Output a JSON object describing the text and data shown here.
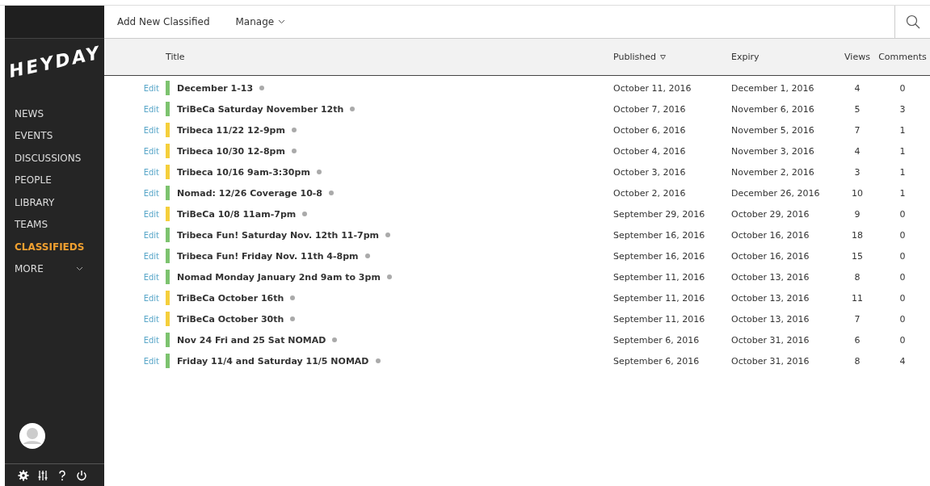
{
  "logo": "HEYDAY",
  "nav": [
    {
      "label": "NEWS",
      "selected": false
    },
    {
      "label": "EVENTS",
      "selected": false
    },
    {
      "label": "DISCUSSIONS",
      "selected": false
    },
    {
      "label": "PEOPLE",
      "selected": false
    },
    {
      "label": "LIBRARY",
      "selected": false
    },
    {
      "label": "TEAMS",
      "selected": false
    },
    {
      "label": "CLASSIFIEDS",
      "selected": true
    },
    {
      "label": "MORE",
      "selected": false,
      "has_menu": true
    }
  ],
  "toolbar": {
    "add": "Add New Classified",
    "manage": "Manage"
  },
  "columns": {
    "title": "Title",
    "published": "Published",
    "expiry": "Expiry",
    "views": "Views",
    "comments": "Comments"
  },
  "rows": [
    {
      "edit": "Edit",
      "color": "#7dc36f",
      "title": "December 1-13",
      "published": "October 11, 2016",
      "expiry": "December 1, 2016",
      "views": "4",
      "comments": "0"
    },
    {
      "edit": "Edit",
      "color": "#7dc36f",
      "title": "TriBeCa Saturday November 12th",
      "published": "October 7, 2016",
      "expiry": "November 6, 2016",
      "views": "5",
      "comments": "3"
    },
    {
      "edit": "Edit",
      "color": "#f5cf3c",
      "title": "Tribeca 11/22 12-9pm",
      "published": "October 6, 2016",
      "expiry": "November 5, 2016",
      "views": "7",
      "comments": "1"
    },
    {
      "edit": "Edit",
      "color": "#f5cf3c",
      "title": "Tribeca 10/30 12-8pm",
      "published": "October 4, 2016",
      "expiry": "November 3, 2016",
      "views": "4",
      "comments": "1"
    },
    {
      "edit": "Edit",
      "color": "#f5cf3c",
      "title": "Tribeca 10/16 9am-3:30pm",
      "published": "October 3, 2016",
      "expiry": "November 2, 2016",
      "views": "3",
      "comments": "1"
    },
    {
      "edit": "Edit",
      "color": "#7dc36f",
      "title": "Nomad: 12/26 Coverage 10-8",
      "published": "October 2, 2016",
      "expiry": "December 26, 2016",
      "views": "10",
      "comments": "1"
    },
    {
      "edit": "Edit",
      "color": "#f5cf3c",
      "title": "TriBeCa 10/8 11am-7pm",
      "published": "September 29, 2016",
      "expiry": "October 29, 2016",
      "views": "9",
      "comments": "0"
    },
    {
      "edit": "Edit",
      "color": "#7dc36f",
      "title": "Tribeca Fun! Saturday Nov. 12th 11-7pm",
      "published": "September 16, 2016",
      "expiry": "October 16, 2016",
      "views": "18",
      "comments": "0"
    },
    {
      "edit": "Edit",
      "color": "#7dc36f",
      "title": "Tribeca Fun! Friday Nov. 11th 4-8pm",
      "published": "September 16, 2016",
      "expiry": "October 16, 2016",
      "views": "15",
      "comments": "0"
    },
    {
      "edit": "Edit",
      "color": "#7dc36f",
      "title": "Nomad Monday January 2nd 9am to 3pm",
      "published": "September 11, 2016",
      "expiry": "October 13, 2016",
      "views": "8",
      "comments": "0"
    },
    {
      "edit": "Edit",
      "color": "#f5cf3c",
      "title": "TriBeCa October 16th",
      "published": "September 11, 2016",
      "expiry": "October 13, 2016",
      "views": "11",
      "comments": "0"
    },
    {
      "edit": "Edit",
      "color": "#f5cf3c",
      "title": "TriBeCa October 30th",
      "published": "September 11, 2016",
      "expiry": "October 13, 2016",
      "views": "7",
      "comments": "0"
    },
    {
      "edit": "Edit",
      "color": "#7dc36f",
      "title": "Nov 24 Fri and 25 Sat NOMAD",
      "published": "September 6, 2016",
      "expiry": "October 31, 2016",
      "views": "6",
      "comments": "0"
    },
    {
      "edit": "Edit",
      "color": "#7dc36f",
      "title": "Friday 11/4 and Saturday 11/5 NOMAD",
      "published": "September 6, 2016",
      "expiry": "October 31, 2016",
      "views": "8",
      "comments": "4"
    }
  ]
}
